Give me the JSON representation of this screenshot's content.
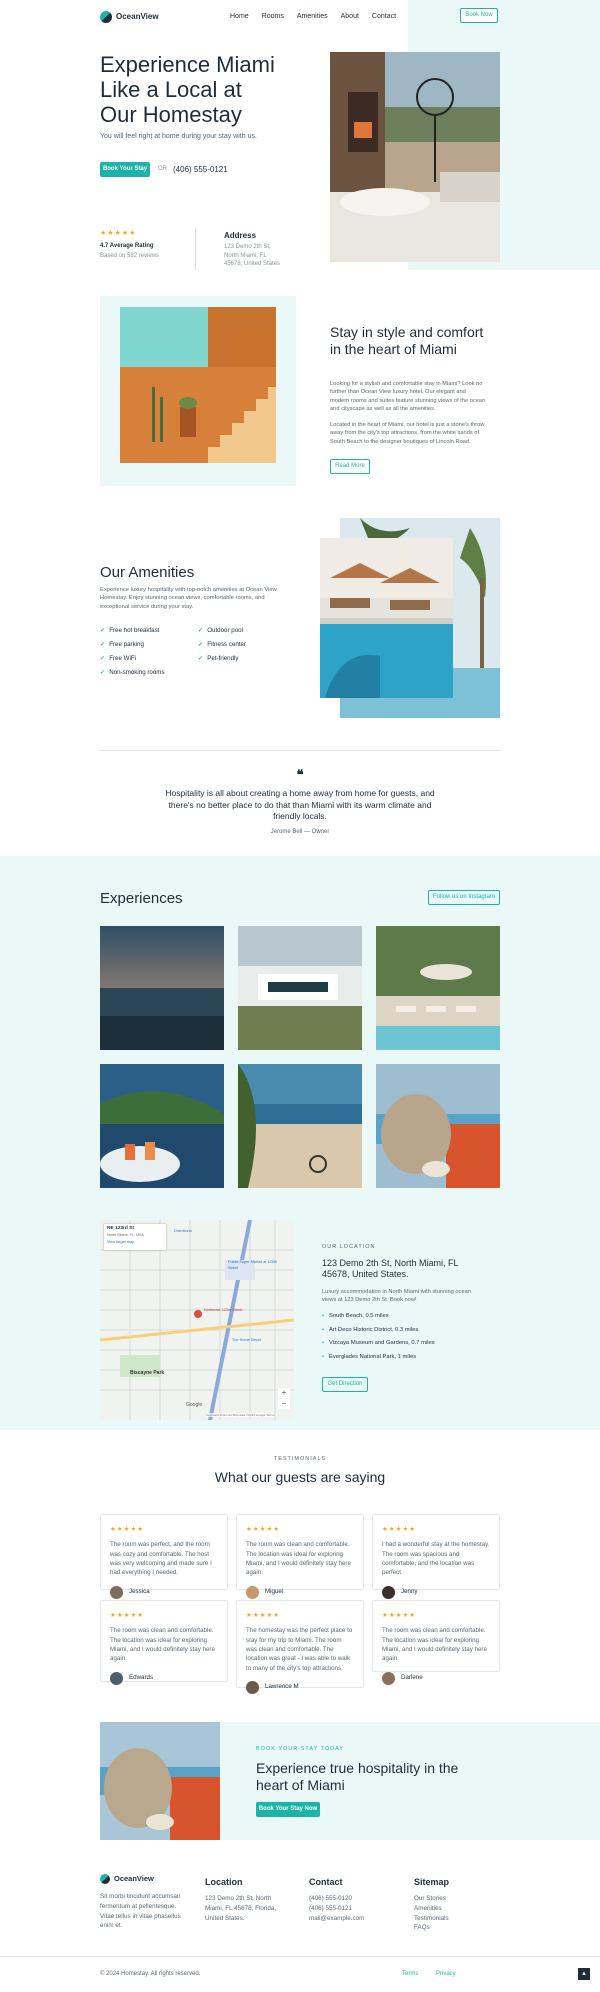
{
  "header": {
    "brand": "OceanView",
    "nav": [
      "Home",
      "Rooms",
      "Amenities",
      "About",
      "Contact"
    ],
    "cta": "Book Now"
  },
  "hero": {
    "title": "Experience Miami Like a Local at Our Homestay",
    "subtitle": "You will feel right at home during your stay with us.",
    "cta": "Book Your Stay",
    "or": "OR",
    "phone": "(406) 555-0121",
    "rating_stars": "★★★★★",
    "rating_label": "4.7 Average Rating",
    "rating_sub": "Based on 582 reviews",
    "address_label": "Address",
    "address_value": "123 Demo 2th St, North Miami, FL 45678, United States"
  },
  "about": {
    "title": "Stay in style and comfort in the heart of Miami",
    "p1": "Looking for a stylish and comfortable stay in Miami? Look no further than Ocean View luxury hotel. Our elegant and modern rooms and suites feature stunning views of the ocean and cityscape as well as all the amenities.",
    "p2": "Located in the heart of Miami, our hotel is just a stone's throw away from the city's top attractions, from the white sands of South Beach to the designer boutiques of Lincoln Road.",
    "cta": "Read More"
  },
  "amenities": {
    "title": "Our Amenities",
    "desc": "Experience luxury hospitality with top-notch amenities at Ocean View Homestay. Enjoy stunning ocean views, comfortable rooms, and exceptional service during your stay.",
    "col1": [
      "Free hot breakfast",
      "Free parking",
      "Free WiFi",
      "Non-smoking rooms"
    ],
    "col2": [
      "Outdoor pool",
      "Fitness center",
      "Pet-friendly"
    ]
  },
  "quote": {
    "mark": "❝",
    "text": "Hospitality is all about creating a home away from home for guests, and there's no better place to do that than Miami with its warm climate and friendly locals.",
    "author": "Jerome Bell — Owner"
  },
  "experiences": {
    "title": "Experiences",
    "cta": "Follow us on Instagram"
  },
  "location": {
    "eyebrow": "OUR LOCATION",
    "address": "123 Demo 2th St, North Miami, FL 45678, United States.",
    "desc": "Luxury accommodation in North Miami with stunning ocean views at 123 Demo 2th St. Book now!",
    "places": [
      "South Beach, 0.5 miles",
      "Art Deco Historic District, 0.3 miles",
      "Vizcaya Museum and Gardens, 0.7 miles",
      "Everglades National Park, 1 miles"
    ],
    "cta": "Get Direction",
    "map": {
      "card_title": "NE 123rd St",
      "card_sub": "North Miami, FL, USA",
      "card_link": "View larger map",
      "directions": "Directions",
      "labels": [
        "Biscayne Park",
        "Northeast 123rd Street",
        "Publix Super Market at 125th Street",
        "The Home Depot",
        "Google"
      ],
      "footer": "Keyboard shortcuts  Map data ©2024 Google  Terms"
    }
  },
  "testimonials": {
    "eyebrow": "TESTIMONIALS",
    "title": "What our guests are saying",
    "stars": "★★★★★",
    "items": [
      {
        "text": "The room was perfect, and the room was cozy and comfortable. The host was very welcoming and made sure I had everything I needed.",
        "name": "Jessica"
      },
      {
        "text": "The room was clean and comfortable. The location was ideal for exploring Miami, and I would definitely stay here again.",
        "name": "Miguel"
      },
      {
        "text": "I had a wonderful stay at the homestay. The room was spacious and comfortable, and the location was perfect.",
        "name": "Jenny"
      },
      {
        "text": "The room was clean and comfortable. The location was ideal for exploring Miami, and I would definitely stay here again.",
        "name": "Edwards"
      },
      {
        "text": "The homestay was the perfect place to stay for my trip to Miami. The room was clean and comfortable. The location was great - I was able to walk to many of the city's top attractions.",
        "name": "Lawrence M"
      },
      {
        "text": "The room was clean and comfortable. The location was ideal for exploring Miami, and I would definitely stay here again.",
        "name": "Darlene"
      }
    ]
  },
  "cta_banner": {
    "eyebrow": "BOOK YOUR STAY TODAY",
    "title": "Experience true hospitality in the heart of Miami",
    "cta": "Book Your Stay Now"
  },
  "footer": {
    "brand": "OceanView",
    "desc": "Sit morbi tincidunt accumsan fermentum at pellentesque. Vitae tellus in vitae phasellus enim et.",
    "location_h": "Location",
    "location_t": "123 Demo 2th St, North Miami, FL 45678, Florida, United States.",
    "contact_h": "Contact",
    "contact_t": [
      "(406) 555-0120",
      "(406) 555-0121",
      "mail@example.com"
    ],
    "sitemap_h": "Sitemap",
    "sitemap_t": [
      "Our Stories",
      "Amenities",
      "Testimonials",
      "FAQs"
    ],
    "copyright": "© 2024 Homestay. All rights reserved.",
    "links": [
      "Terms",
      "Privacy"
    ],
    "top": "▲"
  },
  "colors": {
    "accent": "#1bb5a7",
    "mint": "#eaf8f7",
    "ink": "#1f2d3a"
  }
}
